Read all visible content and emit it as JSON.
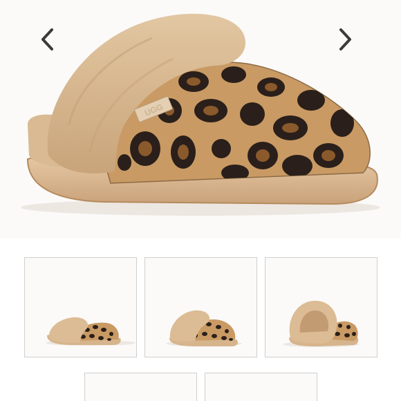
{
  "product_gallery": {
    "main_image": {
      "icon": "leopard-slipper-image",
      "brand_tag": "UGG"
    },
    "prev_arrow_icon": "chevron-left-icon",
    "next_arrow_icon": "chevron-right-icon",
    "thumbnails": [
      {
        "icon": "leopard-slipper-side-thumbnail",
        "selected": false
      },
      {
        "icon": "leopard-slipper-front-thumbnail",
        "selected": false
      },
      {
        "icon": "leopard-slipper-back-thumbnail",
        "selected": false
      },
      {
        "icon": "thumbnail",
        "selected": false
      },
      {
        "icon": "thumbnail",
        "selected": false
      }
    ]
  },
  "colors": {
    "fur": "#d7b78f",
    "leopard_base": "#c99a64",
    "spot_dark": "#2a1f1a",
    "spot_brown": "#8a5a2c",
    "thumb_border": "#cfcfcf",
    "arrow": "#3a3a3a"
  }
}
